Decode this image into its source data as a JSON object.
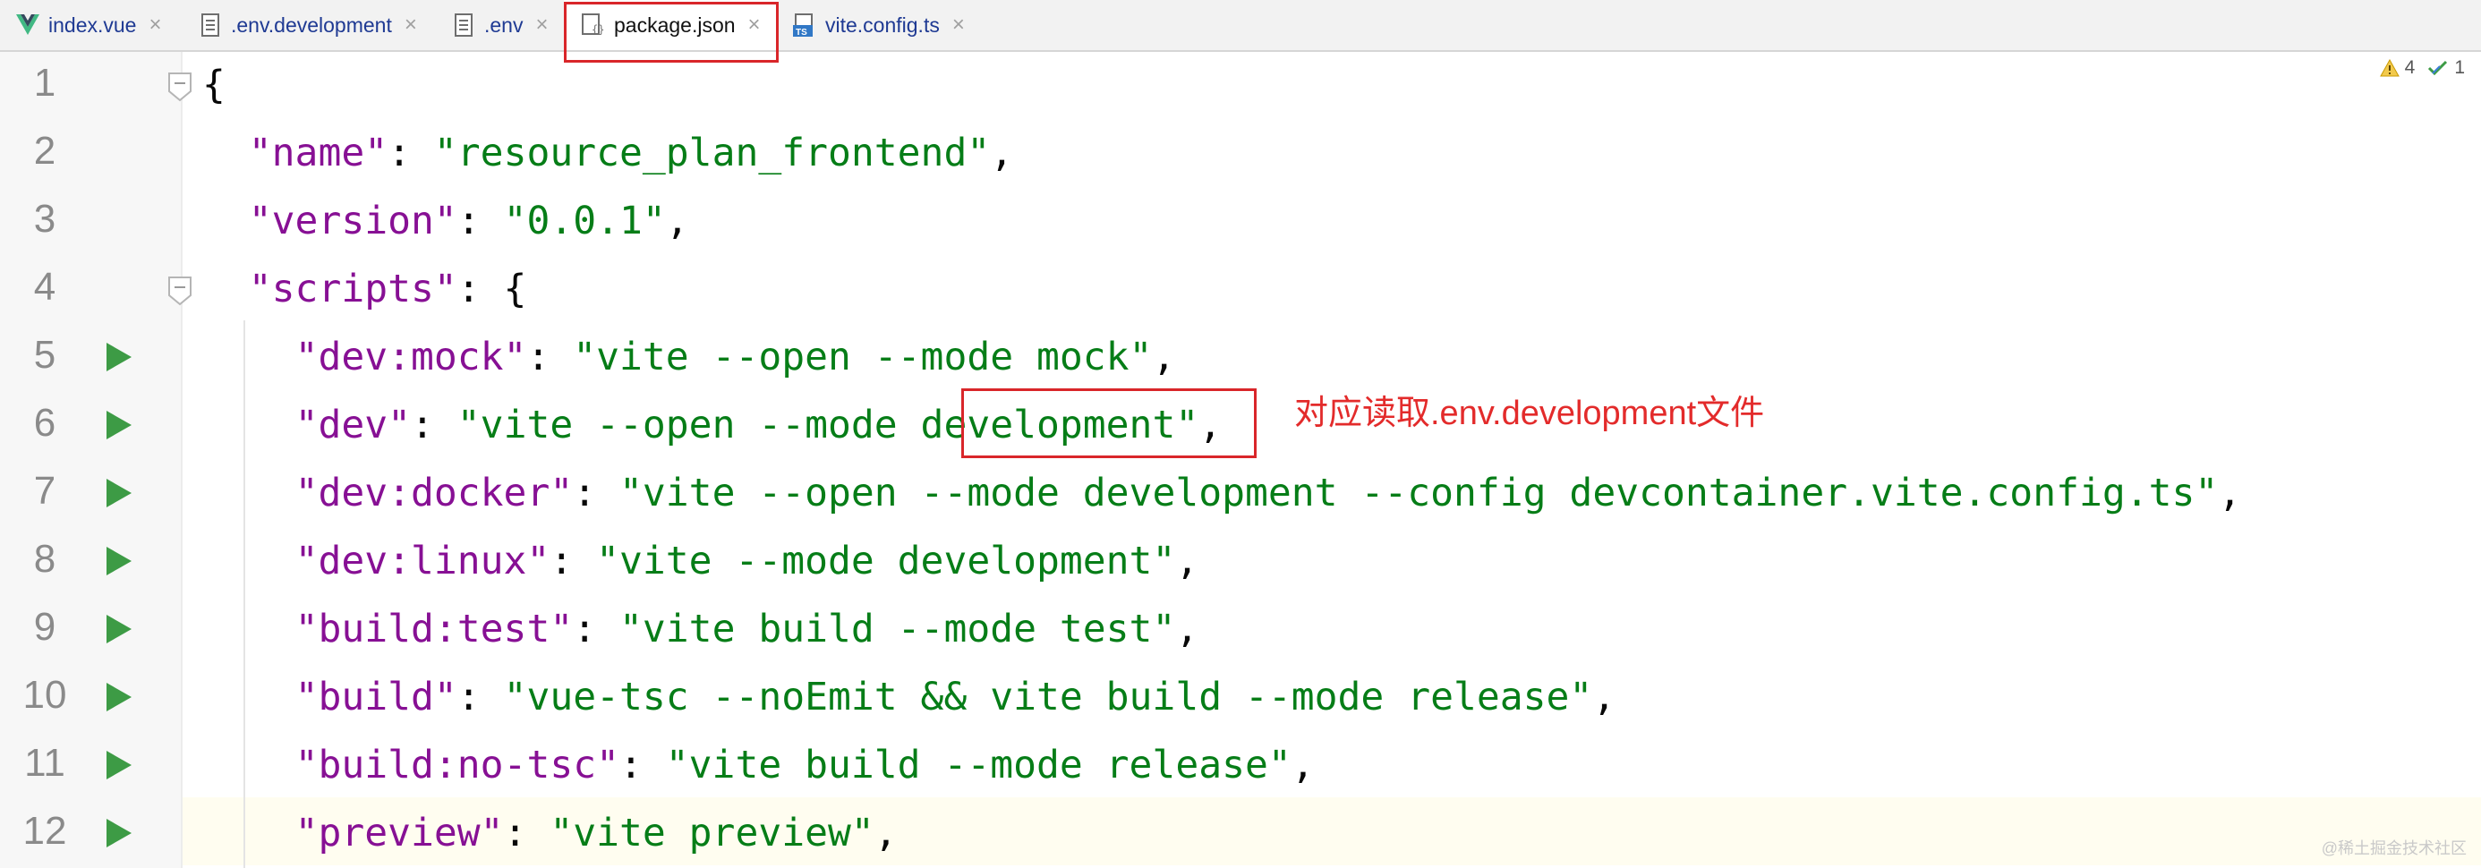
{
  "tabs": [
    {
      "label": "index.vue",
      "icon": "vue-file-icon",
      "active": false
    },
    {
      "label": ".env.development",
      "icon": "text-file-icon",
      "active": false
    },
    {
      "label": ".env",
      "icon": "text-file-icon",
      "active": false
    },
    {
      "label": "package.json",
      "icon": "json-file-icon",
      "active": true
    },
    {
      "label": "vite.config.ts",
      "icon": "typescript-file-icon",
      "active": false
    }
  ],
  "tab_close_glyph": "×",
  "inspections": {
    "warnings": "4",
    "ok": "1"
  },
  "lines": [
    {
      "no": "1",
      "tokens": [
        {
          "t": "{",
          "c": "p"
        }
      ]
    },
    {
      "no": "2",
      "tokens": [
        {
          "t": "  ",
          "c": "p"
        },
        {
          "t": "\"name\"",
          "c": "k"
        },
        {
          "t": ": ",
          "c": "p"
        },
        {
          "t": "\"resource_plan_frontend\"",
          "c": "s"
        },
        {
          "t": ",",
          "c": "p"
        }
      ]
    },
    {
      "no": "3",
      "tokens": [
        {
          "t": "  ",
          "c": "p"
        },
        {
          "t": "\"version\"",
          "c": "k"
        },
        {
          "t": ": ",
          "c": "p"
        },
        {
          "t": "\"0.0.1\"",
          "c": "s"
        },
        {
          "t": ",",
          "c": "p"
        }
      ]
    },
    {
      "no": "4",
      "tokens": [
        {
          "t": "  ",
          "c": "p"
        },
        {
          "t": "\"scripts\"",
          "c": "k"
        },
        {
          "t": ": {",
          "c": "p"
        }
      ]
    },
    {
      "no": "5",
      "tokens": [
        {
          "t": "    ",
          "c": "p"
        },
        {
          "t": "\"dev:mock\"",
          "c": "k"
        },
        {
          "t": ": ",
          "c": "p"
        },
        {
          "t": "\"vite --open --mode mock\"",
          "c": "s"
        },
        {
          "t": ",",
          "c": "p"
        }
      ]
    },
    {
      "no": "6",
      "tokens": [
        {
          "t": "    ",
          "c": "p"
        },
        {
          "t": "\"dev\"",
          "c": "k"
        },
        {
          "t": ": ",
          "c": "p"
        },
        {
          "t": "\"vite --open --mode development\"",
          "c": "s"
        },
        {
          "t": ",",
          "c": "p"
        }
      ]
    },
    {
      "no": "7",
      "tokens": [
        {
          "t": "    ",
          "c": "p"
        },
        {
          "t": "\"dev:docker\"",
          "c": "k"
        },
        {
          "t": ": ",
          "c": "p"
        },
        {
          "t": "\"vite --open --mode development --config devcontainer.vite.config.ts\"",
          "c": "s"
        },
        {
          "t": ",",
          "c": "p"
        }
      ]
    },
    {
      "no": "8",
      "tokens": [
        {
          "t": "    ",
          "c": "p"
        },
        {
          "t": "\"dev:linux\"",
          "c": "k"
        },
        {
          "t": ": ",
          "c": "p"
        },
        {
          "t": "\"vite --mode development\"",
          "c": "s"
        },
        {
          "t": ",",
          "c": "p"
        }
      ]
    },
    {
      "no": "9",
      "tokens": [
        {
          "t": "    ",
          "c": "p"
        },
        {
          "t": "\"build:test\"",
          "c": "k"
        },
        {
          "t": ": ",
          "c": "p"
        },
        {
          "t": "\"vite build --mode test\"",
          "c": "s"
        },
        {
          "t": ",",
          "c": "p"
        }
      ]
    },
    {
      "no": "10",
      "tokens": [
        {
          "t": "    ",
          "c": "p"
        },
        {
          "t": "\"build\"",
          "c": "k"
        },
        {
          "t": ": ",
          "c": "p"
        },
        {
          "t": "\"vue-tsc --noEmit && vite build --mode release\"",
          "c": "s"
        },
        {
          "t": ",",
          "c": "p"
        }
      ]
    },
    {
      "no": "11",
      "tokens": [
        {
          "t": "    ",
          "c": "p"
        },
        {
          "t": "\"build:no-tsc\"",
          "c": "k"
        },
        {
          "t": ": ",
          "c": "p"
        },
        {
          "t": "\"vite build --mode release\"",
          "c": "s"
        },
        {
          "t": ",",
          "c": "p"
        }
      ]
    },
    {
      "no": "12",
      "tokens": [
        {
          "t": "    ",
          "c": "p"
        },
        {
          "t": "\"preview\"",
          "c": "k"
        },
        {
          "t": ": ",
          "c": "p"
        },
        {
          "t": "\"vite preview\"",
          "c": "s"
        },
        {
          "t": ",",
          "c": "p"
        }
      ]
    }
  ],
  "annotation": "对应读取.env.development文件",
  "watermark": "@稀土掘金技术社区",
  "colors": {
    "key": "#871094",
    "string": "#067d17",
    "punct": "#080808",
    "annotation": "#e32b2b",
    "run": "#3d9b45"
  }
}
